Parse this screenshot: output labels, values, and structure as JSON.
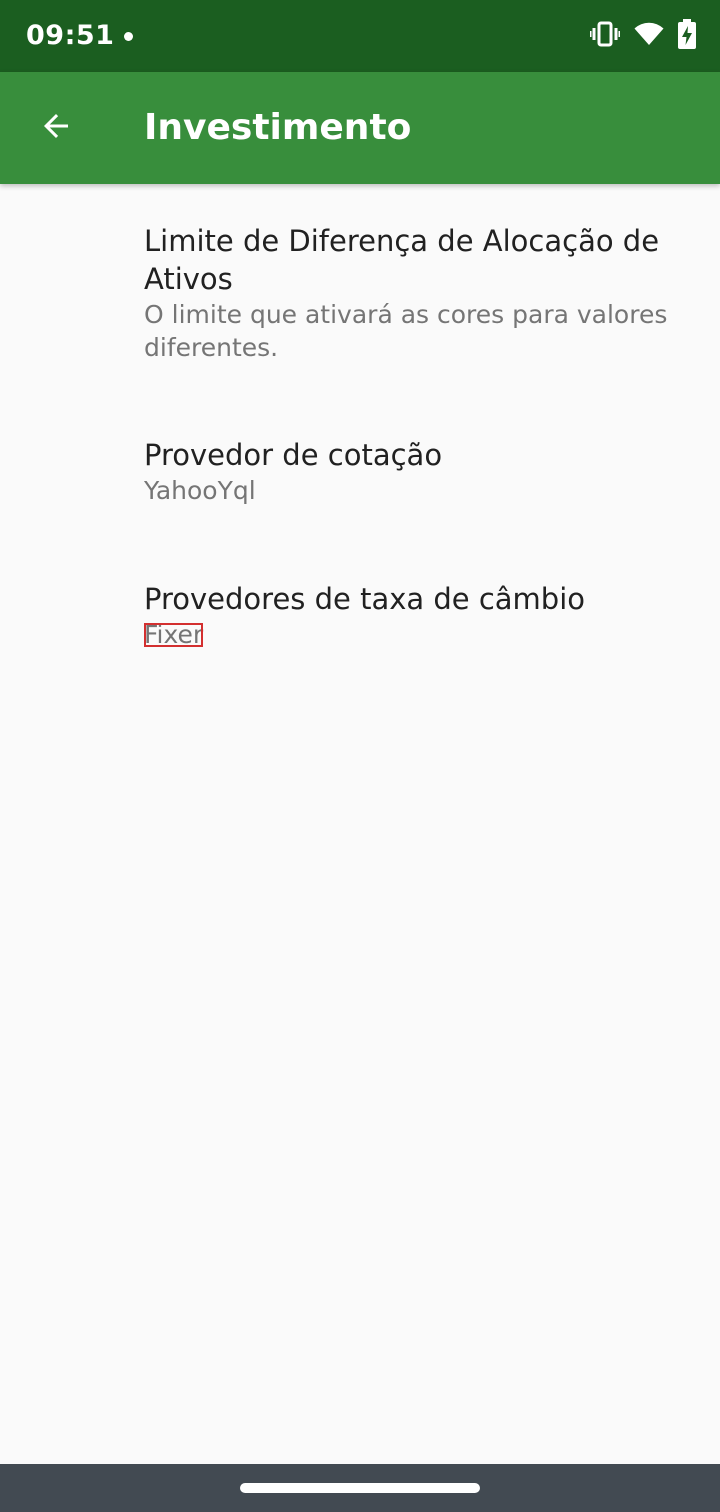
{
  "status_bar": {
    "time": "09:51",
    "icons": [
      "notification-dot-icon",
      "vibrate-icon",
      "wifi-icon",
      "battery-charging-icon"
    ]
  },
  "app_bar": {
    "title": "Investimento",
    "back_icon": "arrow-back-icon"
  },
  "preferences": [
    {
      "title": "Limite de Diferença de Alocação de Ativos",
      "summary": "O limite que ativará as cores para valores diferentes."
    },
    {
      "title": "Provedor de cotação",
      "summary": "YahooYql"
    },
    {
      "title": "Provedores de taxa de câmbio",
      "summary": "Fixer"
    }
  ],
  "colors": {
    "status_bar": "#1b5e20",
    "app_bar": "#388e3c",
    "background": "#fafafa",
    "nav_bar": "#424a52",
    "highlight_box": "#d32f2f"
  }
}
